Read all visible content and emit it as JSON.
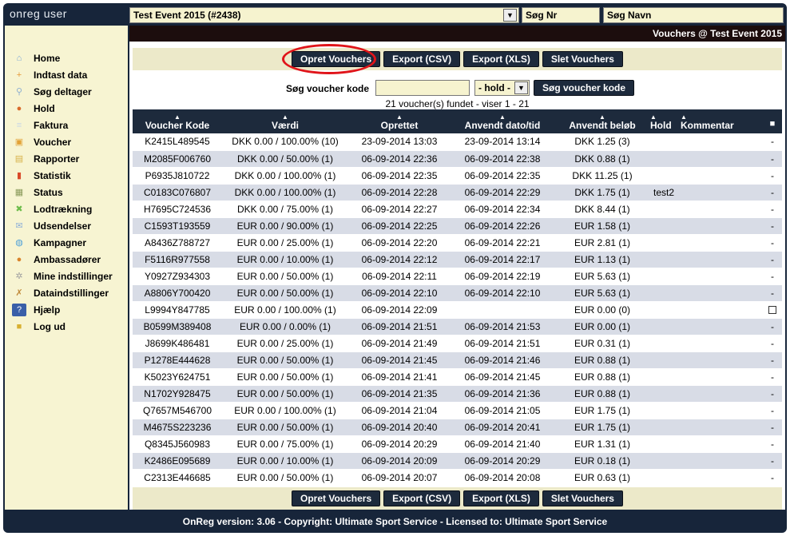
{
  "app": {
    "brand": "onreg user"
  },
  "topbar": {
    "event_select_value": "Test Event 2015 (#2438)",
    "search_nr_label": "Søg Nr",
    "search_navn_label": "Søg Navn"
  },
  "sidebar": {
    "items": [
      {
        "label": "Home",
        "icon": "home-icon"
      },
      {
        "label": "Indtast data",
        "icon": "user-add-icon"
      },
      {
        "label": "Søg deltager",
        "icon": "search-icon"
      },
      {
        "label": "Hold",
        "icon": "team-icon"
      },
      {
        "label": "Faktura",
        "icon": "invoice-icon"
      },
      {
        "label": "Voucher",
        "icon": "gift-icon"
      },
      {
        "label": "Rapporter",
        "icon": "folder-icon"
      },
      {
        "label": "Statistik",
        "icon": "bar-chart-icon"
      },
      {
        "label": "Status",
        "icon": "status-icon"
      },
      {
        "label": "Lodtrækning",
        "icon": "lottery-icon"
      },
      {
        "label": "Udsendelser",
        "icon": "mail-icon"
      },
      {
        "label": "Kampagner",
        "icon": "globe-icon"
      },
      {
        "label": "Ambassadører",
        "icon": "people-icon"
      },
      {
        "label": "Mine indstillinger",
        "icon": "gear-icon"
      },
      {
        "label": "Dataindstillinger",
        "icon": "tools-icon"
      },
      {
        "label": "Hjælp",
        "icon": "help-icon"
      },
      {
        "label": "Log ud",
        "icon": "lock-icon"
      }
    ]
  },
  "main": {
    "header": "Vouchers @ Test Event 2015",
    "toolbar": {
      "create": "Opret Vouchers",
      "export_csv": "Export (CSV)",
      "export_xls": "Export (XLS)",
      "delete": "Slet Vouchers"
    },
    "search": {
      "label": "Søg voucher kode",
      "input_value": "",
      "hold_value": "- hold -",
      "button": "Søg voucher kode"
    },
    "found_text": "21 voucher(s) fundet - viser 1 - 21",
    "columns": [
      "Voucher Kode",
      "Værdi",
      "Oprettet",
      "Anvendt dato/tid",
      "Anvendt beløb",
      "Hold",
      "Kommentar"
    ],
    "rows": [
      [
        "K2415L489545",
        "DKK 0.00 / 100.00% (10)",
        "23-09-2014 13:03",
        "23-09-2014 13:14",
        "DKK 1.25 (3)",
        "",
        "-"
      ],
      [
        "M2085F006760",
        "DKK 0.00 / 50.00% (1)",
        "06-09-2014 22:36",
        "06-09-2014 22:38",
        "DKK 0.88 (1)",
        "",
        "-"
      ],
      [
        "P6935J810722",
        "DKK 0.00 / 100.00% (1)",
        "06-09-2014 22:35",
        "06-09-2014 22:35",
        "DKK 11.25 (1)",
        "",
        "-"
      ],
      [
        "C0183C076807",
        "DKK 0.00 / 100.00% (1)",
        "06-09-2014 22:28",
        "06-09-2014 22:29",
        "DKK 1.75 (1)",
        "test2",
        "-"
      ],
      [
        "H7695C724536",
        "DKK 0.00 / 75.00% (1)",
        "06-09-2014 22:27",
        "06-09-2014 22:34",
        "DKK 8.44 (1)",
        "",
        "-"
      ],
      [
        "C1593T193559",
        "EUR 0.00 / 90.00% (1)",
        "06-09-2014 22:25",
        "06-09-2014 22:26",
        "EUR 1.58 (1)",
        "",
        "-"
      ],
      [
        "A8436Z788727",
        "EUR 0.00 / 25.00% (1)",
        "06-09-2014 22:20",
        "06-09-2014 22:21",
        "EUR 2.81 (1)",
        "",
        "-"
      ],
      [
        "F5116R977558",
        "EUR 0.00 / 10.00% (1)",
        "06-09-2014 22:12",
        "06-09-2014 22:17",
        "EUR 1.13 (1)",
        "",
        "-"
      ],
      [
        "Y0927Z934303",
        "EUR 0.00 / 50.00% (1)",
        "06-09-2014 22:11",
        "06-09-2014 22:19",
        "EUR 5.63 (1)",
        "",
        "-"
      ],
      [
        "A8806Y700420",
        "EUR 0.00 / 50.00% (1)",
        "06-09-2014 22:10",
        "06-09-2014 22:10",
        "EUR 5.63 (1)",
        "",
        "-"
      ],
      [
        "L9994Y847785",
        "EUR 0.00 / 100.00% (1)",
        "06-09-2014 22:09",
        "",
        "EUR 0.00 (0)",
        "",
        "checkbox"
      ],
      [
        "B0599M389408",
        "EUR 0.00 / 0.00% (1)",
        "06-09-2014 21:51",
        "06-09-2014 21:53",
        "EUR 0.00 (1)",
        "",
        "-"
      ],
      [
        "J8699K486481",
        "EUR 0.00 / 25.00% (1)",
        "06-09-2014 21:49",
        "06-09-2014 21:51",
        "EUR 0.31 (1)",
        "",
        "-"
      ],
      [
        "P1278E444628",
        "EUR 0.00 / 50.00% (1)",
        "06-09-2014 21:45",
        "06-09-2014 21:46",
        "EUR 0.88 (1)",
        "",
        "-"
      ],
      [
        "K5023Y624751",
        "EUR 0.00 / 50.00% (1)",
        "06-09-2014 21:41",
        "06-09-2014 21:45",
        "EUR 0.88 (1)",
        "",
        "-"
      ],
      [
        "N1702Y928475",
        "EUR 0.00 / 50.00% (1)",
        "06-09-2014 21:35",
        "06-09-2014 21:36",
        "EUR 0.88 (1)",
        "",
        "-"
      ],
      [
        "Q7657M546700",
        "EUR 0.00 / 100.00% (1)",
        "06-09-2014 21:04",
        "06-09-2014 21:05",
        "EUR 1.75 (1)",
        "",
        "-"
      ],
      [
        "M4675S223236",
        "EUR 0.00 / 50.00% (1)",
        "06-09-2014 20:40",
        "06-09-2014 20:41",
        "EUR 1.75 (1)",
        "",
        "-"
      ],
      [
        "Q8345J560983",
        "EUR 0.00 / 75.00% (1)",
        "06-09-2014 20:29",
        "06-09-2014 21:40",
        "EUR 1.31 (1)",
        "",
        "-"
      ],
      [
        "K2486E095689",
        "EUR 0.00 / 10.00% (1)",
        "06-09-2014 20:09",
        "06-09-2014 20:29",
        "EUR 0.18 (1)",
        "",
        "-"
      ],
      [
        "C2313E446685",
        "EUR 0.00 / 50.00% (1)",
        "06-09-2014 20:07",
        "06-09-2014 20:08",
        "EUR 0.63 (1)",
        "",
        "-"
      ]
    ]
  },
  "footer": {
    "text": "OnReg version: 3.06 - Copyright: Ultimate Sport Service - Licensed to: Ultimate Sport Service"
  },
  "colors": {
    "navy": "#1d2a3c",
    "cream": "#f7f4d2",
    "highlight": "#e0141a",
    "row_alt": "#d8dce6"
  }
}
